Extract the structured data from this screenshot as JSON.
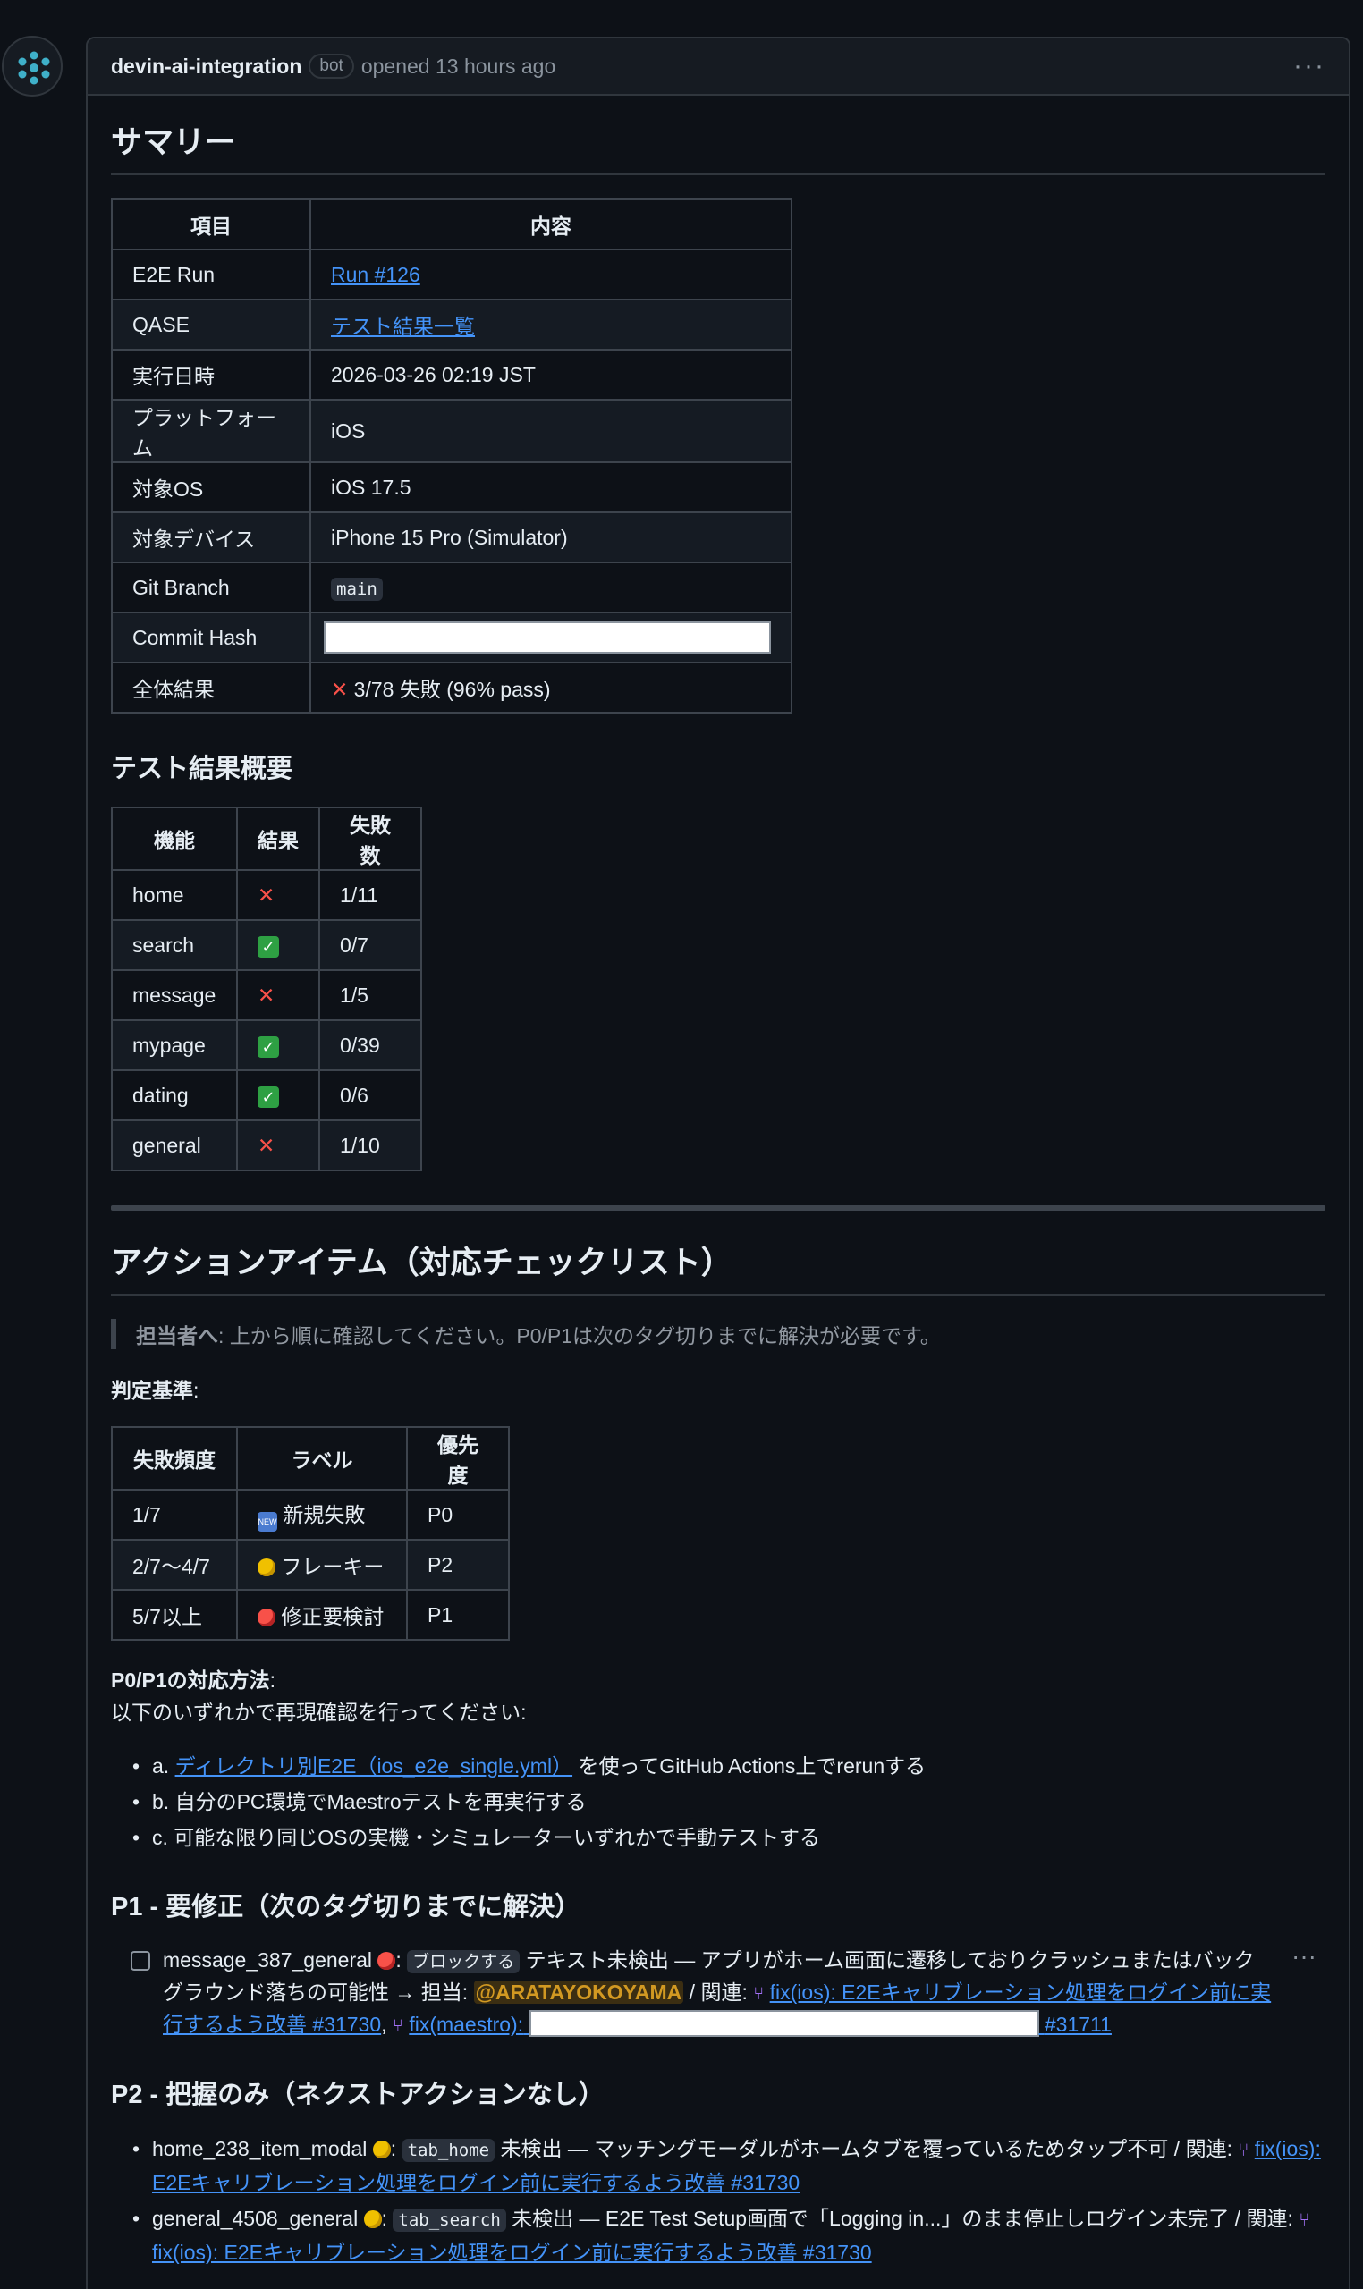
{
  "header": {
    "author": "devin-ai-integration",
    "badge": "bot",
    "action": "opened 13 hours ago",
    "menu": "···"
  },
  "summary": {
    "title": "サマリー",
    "headers": [
      "項目",
      "内容"
    ],
    "rows": [
      {
        "key": "E2E Run",
        "value": "Run #126",
        "type": "link"
      },
      {
        "key": "QASE",
        "value": "テスト結果一覧",
        "type": "link"
      },
      {
        "key": "実行日時",
        "value": "2026-03-26 02:19 JST",
        "type": "text"
      },
      {
        "key": "プラットフォーム",
        "value": "iOS",
        "type": "text"
      },
      {
        "key": "対象OS",
        "value": "iOS 17.5",
        "type": "text"
      },
      {
        "key": "対象デバイス",
        "value": "iPhone 15 Pro (Simulator)",
        "type": "text"
      },
      {
        "key": "Git Branch",
        "value": "main",
        "type": "code"
      },
      {
        "key": "Commit Hash",
        "value": "",
        "type": "redacted"
      },
      {
        "key": "全体結果",
        "value": "3/78 失敗 (96% pass)",
        "type": "fail"
      }
    ]
  },
  "results": {
    "title": "テスト結果概要",
    "headers": [
      "機能",
      "結果",
      "失敗数"
    ],
    "rows": [
      {
        "name": "home",
        "status": "fail",
        "count": "1/11"
      },
      {
        "name": "search",
        "status": "pass",
        "count": "0/7"
      },
      {
        "name": "message",
        "status": "fail",
        "count": "1/5"
      },
      {
        "name": "mypage",
        "status": "pass",
        "count": "0/39"
      },
      {
        "name": "dating",
        "status": "pass",
        "count": "0/6"
      },
      {
        "name": "general",
        "status": "fail",
        "count": "1/10"
      }
    ]
  },
  "actions": {
    "title": "アクションアイテム（対応チェックリスト）",
    "quote_bold": "担当者へ",
    "quote_text": ": 上から順に確認してください。P0/P1は次のタグ切りまでに解決が必要です。",
    "criteria_label": "判定基準",
    "criteria_headers": [
      "失敗頻度",
      "ラベル",
      "優先度"
    ],
    "criteria_rows": [
      {
        "freq": "1/7",
        "icon": "new",
        "label": "新規失敗",
        "priority": "P0"
      },
      {
        "freq": "2/7〜4/7",
        "icon": "yellow",
        "label": "フレーキー",
        "priority": "P2"
      },
      {
        "freq": "5/7以上",
        "icon": "red",
        "label": "修正要検討",
        "priority": "P1"
      }
    ],
    "method_label": "P0/P1の対応方法",
    "method_intro": "以下のいずれかで再現確認を行ってください:",
    "method_a_prefix": "a. ",
    "method_a_link": "ディレクトリ別E2E（ios_e2e_single.yml）",
    "method_a_suffix": " を使ってGitHub Actions上でrerunする",
    "method_b": "b. 自分のPC環境でMaestroテストを再実行する",
    "method_c": "c. 可能な限り同じOSの実機・シミュレーターいずれかで手動テストする"
  },
  "p1": {
    "title": "P1 - 要修正（次のタグ切りまでに解決）",
    "test_name": "message_387_general",
    "code": "ブロックする",
    "text1": " テキスト未検出 — アプリがホーム画面に遷移しておりクラッシュまたはバックグラウンド落ちの可能性 → 担当: ",
    "mention": "@ARATAYOKOYAMA",
    "text2": " / 関連: ",
    "pr1": "fix(ios): E2Eキャリブレーション処理をログイン前に実行するよう改善 #31730",
    "pr2_prefix": "fix(maestro):",
    "pr2_number": "#31711",
    "menu": "···"
  },
  "p2": {
    "title": "P2 - 把握のみ（ネクストアクションなし）",
    "items": [
      {
        "name": "home_238_item_modal",
        "code": "tab_home",
        "text": " 未検出 — マッチングモーダルがホームタブを覆っているためタップ不可 / 関連: ",
        "pr": "fix(ios): E2Eキャリブレーション処理をログイン前に実行するよう改善 #31730"
      },
      {
        "name": "general_4508_general",
        "code": "tab_search",
        "text": " 未検出 — E2E Test Setup画面で「Logging in...」のまま停止しログイン未完了 / 関連: ",
        "pr": "fix(ios): E2Eキャリブレーション処理をログイン前に実行するよう改善 #31730"
      }
    ]
  }
}
